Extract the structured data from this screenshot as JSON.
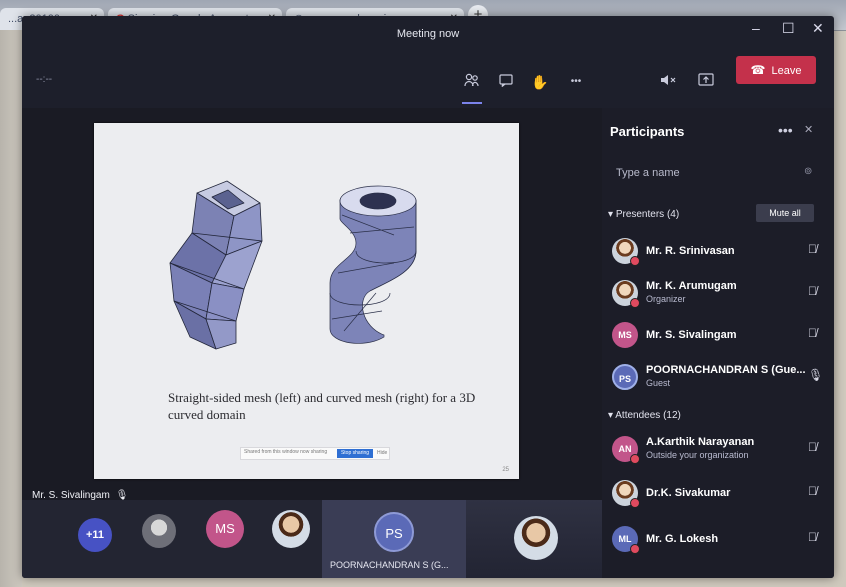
{
  "browser": {
    "tabs": [
      {
        "label": "...an20100..."
      },
      {
        "label": "Sign in - Google Accounts"
      },
      {
        "label": "www.google.co.in"
      }
    ]
  },
  "window": {
    "title": "Meeting now",
    "controls": {
      "minimize": "–",
      "maximize": "☐",
      "close": "✕"
    }
  },
  "toolbar": {
    "small_text": "--:--",
    "more": "•••",
    "leave_label": "Leave"
  },
  "slide": {
    "caption": "Straight-sided mesh (left) and curved mesh (right) for a 3D curved domain",
    "bar_text": "Shared from this window now sharing",
    "bar_button": "Stop sharing",
    "bar_hide": "Hide",
    "page": "25"
  },
  "stage": {
    "presenter_name": "Mr. S. Sivalingam"
  },
  "panel": {
    "title": "Participants",
    "more": "•••",
    "close": "✕",
    "search_placeholder": "Type a name",
    "presenters_header": "Presenters (4)",
    "mute_all_label": "Mute all",
    "attendees_header": "Attendees (12)",
    "presenters": [
      {
        "initials": "",
        "name": "Mr. R. Srinivasan",
        "sub": ""
      },
      {
        "initials": "",
        "name": "Mr. K. Arumugam",
        "sub": "Organizer"
      },
      {
        "initials": "MS",
        "name": "Mr. S. Sivalingam",
        "sub": ""
      },
      {
        "initials": "PS",
        "name": "POORNACHANDRAN S (Gue...",
        "sub": "Guest"
      }
    ],
    "attendees": [
      {
        "initials": "AN",
        "name": "A.Karthik Narayanan",
        "sub": "Outside your organization"
      },
      {
        "initials": "",
        "name": "Dr.K. Sivakumar",
        "sub": ""
      },
      {
        "initials": "ML",
        "name": "Mr. G. Lokesh",
        "sub": ""
      }
    ]
  },
  "gallery": {
    "more_count": "+11",
    "ms_initials": "MS",
    "active_initials": "PS",
    "active_name": "POORNACHANDRAN S (G..."
  },
  "colors": {
    "accent": "#7b83eb",
    "leave": "#c4314b",
    "window_bg": "#1d1f2b"
  }
}
